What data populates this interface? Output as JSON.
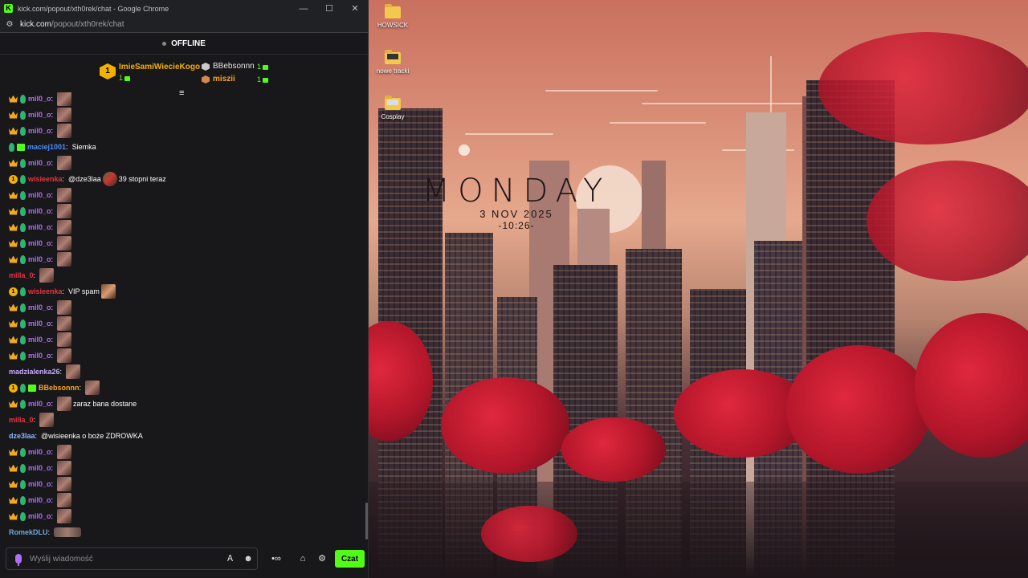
{
  "window": {
    "title": "kick.com/popout/xth0rek/chat - Google Chrome",
    "favicon_letter": "K",
    "minimize": "—",
    "maximize": "☐",
    "close": "✕"
  },
  "address": {
    "host": "kick.com",
    "path": "/popout/xth0rek/chat"
  },
  "stream": {
    "status": "OFFLINE"
  },
  "top_gifters": [
    {
      "rank": "1",
      "name": "ImieSamiWiecieKogo",
      "count": "1"
    },
    {
      "name": "BBebsonnn",
      "count": "1"
    },
    {
      "name": "miszii",
      "count": "1"
    }
  ],
  "messages": [
    {
      "badges": [
        "crown",
        "leaf"
      ],
      "user": "mil0_o",
      "user_color": "#b36df5",
      "text": "",
      "emotes": [
        "a"
      ]
    },
    {
      "badges": [
        "crown",
        "leaf"
      ],
      "user": "mil0_o",
      "user_color": "#b36df5",
      "text": "",
      "emotes": [
        "a"
      ]
    },
    {
      "badges": [
        "crown",
        "leaf"
      ],
      "user": "mil0_o",
      "user_color": "#b36df5",
      "text": "",
      "emotes": [
        "a"
      ]
    },
    {
      "badges": [
        "leaf",
        "gift"
      ],
      "user": "maciej1001",
      "user_color": "#4b8dfa",
      "text": "Siemka",
      "emotes": []
    },
    {
      "badges": [
        "crown",
        "leaf"
      ],
      "user": "mil0_o",
      "user_color": "#b36df5",
      "text": "",
      "emotes": [
        "a"
      ]
    },
    {
      "badges": [
        "one",
        "leaf"
      ],
      "user": "wisieenka",
      "user_color": "#e8343f",
      "text": "@dze3laa",
      "text2": "39 stopni teraz",
      "emotes": [
        "c"
      ]
    },
    {
      "badges": [
        "crown",
        "leaf"
      ],
      "user": "mil0_o",
      "user_color": "#b36df5",
      "text": "",
      "emotes": [
        "a"
      ]
    },
    {
      "badges": [
        "crown",
        "leaf"
      ],
      "user": "mil0_o",
      "user_color": "#b36df5",
      "text": "",
      "emotes": [
        "a"
      ]
    },
    {
      "badges": [
        "crown",
        "leaf"
      ],
      "user": "mil0_o",
      "user_color": "#b36df5",
      "text": "",
      "emotes": [
        "a"
      ]
    },
    {
      "badges": [
        "crown",
        "leaf"
      ],
      "user": "mil0_o",
      "user_color": "#b36df5",
      "text": "",
      "emotes": [
        "a"
      ]
    },
    {
      "badges": [
        "crown",
        "leaf"
      ],
      "user": "mil0_o",
      "user_color": "#b36df5",
      "text": "",
      "emotes": [
        "a"
      ]
    },
    {
      "badges": [],
      "user": "milla_0",
      "user_color": "#e8343f",
      "text": "",
      "emotes": [
        "a"
      ]
    },
    {
      "badges": [
        "one",
        "leaf"
      ],
      "user": "wisieenka",
      "user_color": "#e8343f",
      "text": "VIP spam",
      "emotes": [
        "b"
      ]
    },
    {
      "badges": [
        "crown",
        "leaf"
      ],
      "user": "mil0_o",
      "user_color": "#b36df5",
      "text": "",
      "emotes": [
        "a"
      ]
    },
    {
      "badges": [
        "crown",
        "leaf"
      ],
      "user": "mil0_o",
      "user_color": "#b36df5",
      "text": "",
      "emotes": [
        "a"
      ]
    },
    {
      "badges": [
        "crown",
        "leaf"
      ],
      "user": "mil0_o",
      "user_color": "#b36df5",
      "text": "",
      "emotes": [
        "a"
      ]
    },
    {
      "badges": [
        "crown",
        "leaf"
      ],
      "user": "mil0_o",
      "user_color": "#b36df5",
      "text": "",
      "emotes": [
        "a"
      ]
    },
    {
      "badges": [],
      "user": "madzialenka26",
      "user_color": "#c9a9ff",
      "text": "",
      "emotes": [
        "a"
      ]
    },
    {
      "badges": [
        "one",
        "leaf",
        "gift"
      ],
      "user": "BBebsonnn",
      "user_color": "#f5a623",
      "text": "",
      "emotes": [
        "a"
      ]
    },
    {
      "badges": [
        "crown",
        "leaf"
      ],
      "user": "mil0_o",
      "user_color": "#b36df5",
      "text": "zaraz bana dostane",
      "emotes": [
        "a"
      ],
      "emote_first": true
    },
    {
      "badges": [],
      "user": "milla_0",
      "user_color": "#e8343f",
      "text": "",
      "emotes": [
        "a"
      ]
    },
    {
      "badges": [],
      "user": "dze3laa",
      "user_color": "#8fb8ff",
      "text": "@wisieenka o boże ZDROWKA",
      "emotes": []
    },
    {
      "badges": [
        "crown",
        "leaf"
      ],
      "user": "mil0_o",
      "user_color": "#b36df5",
      "text": "",
      "emotes": [
        "a"
      ]
    },
    {
      "badges": [
        "crown",
        "leaf"
      ],
      "user": "mil0_o",
      "user_color": "#b36df5",
      "text": "",
      "emotes": [
        "a"
      ]
    },
    {
      "badges": [
        "crown",
        "leaf"
      ],
      "user": "mil0_o",
      "user_color": "#b36df5",
      "text": "",
      "emotes": [
        "a"
      ]
    },
    {
      "badges": [
        "crown",
        "leaf"
      ],
      "user": "mil0_o",
      "user_color": "#b36df5",
      "text": "",
      "emotes": [
        "a"
      ]
    },
    {
      "badges": [
        "crown",
        "leaf"
      ],
      "user": "mil0_o",
      "user_color": "#b36df5",
      "text": "",
      "emotes": [
        "a"
      ]
    },
    {
      "badges": [],
      "user": "RomekDLU",
      "user_color": "#6fa8dc",
      "text": "",
      "emotes": [
        "wide"
      ]
    }
  ],
  "chat_input": {
    "placeholder": "Wyślij wiadomość",
    "send_label": "Czat"
  },
  "desktop": {
    "clock": {
      "day": "MONDAY",
      "date": "3 NOV 2025",
      "time": "-10:26-"
    },
    "icons": [
      {
        "label": "HOWSICK"
      },
      {
        "label": "nowe tracki"
      },
      {
        "label": "Cosplay"
      }
    ]
  }
}
